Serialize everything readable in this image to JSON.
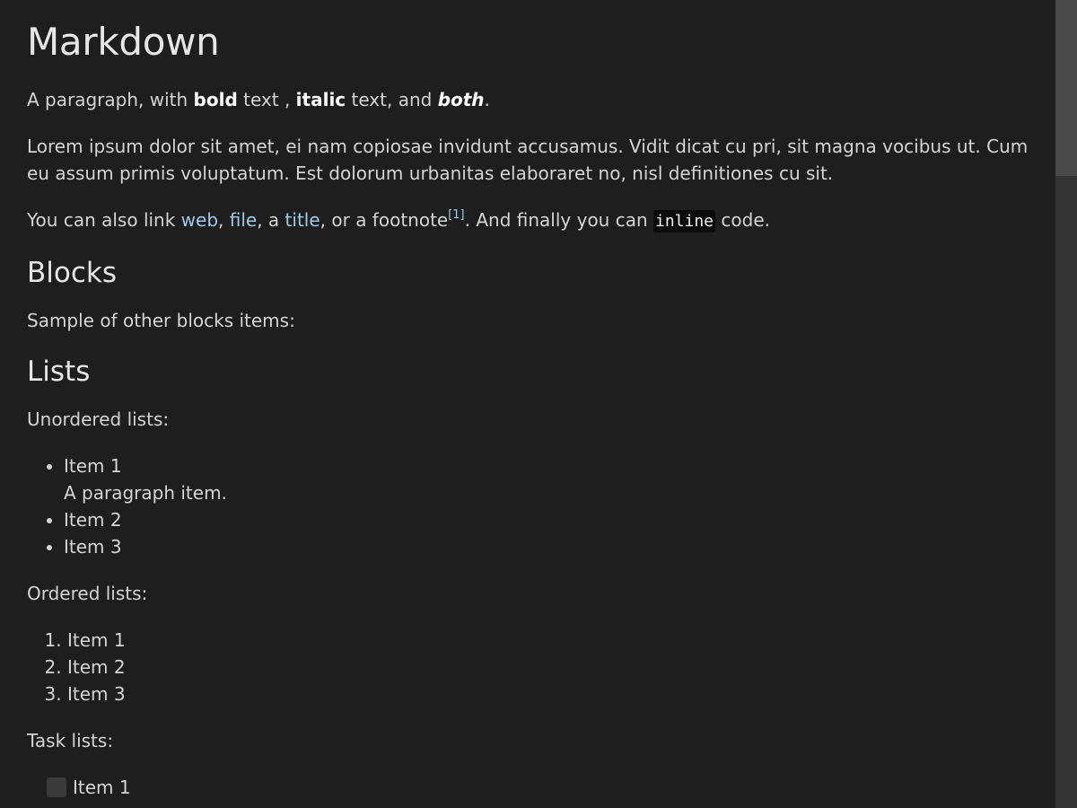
{
  "title": "Markdown",
  "intro": {
    "t1": "A paragraph, with ",
    "bold": "bold",
    "t2": " text , ",
    "italic": "italic",
    "t3": " text, and ",
    "both": "both",
    "t4": "."
  },
  "lorem": "Lorem ipsum dolor sit amet, ei nam copiosae invidunt accusamus. Vidit dicat cu pri, sit magna vocibus ut. Cum eu assum primis voluptatum. Est dolorum urbanitas elaboraret no, nisl definitiones cu sit.",
  "links": {
    "t1": "You can also link ",
    "web": "web",
    "sep1": ", ",
    "file": "file",
    "sep2": ", a ",
    "title_link": "title",
    "sep3": ", or a footnote",
    "footnote": "[1]",
    "t2": ". And finally you can ",
    "code": "inline",
    "t3": " code."
  },
  "blocks": {
    "heading": "Blocks",
    "intro": "Sample of other blocks items:"
  },
  "lists": {
    "heading": "Lists",
    "unordered_label": "Unordered lists:",
    "unordered": [
      "Item 1",
      "Item 2",
      "Item 3"
    ],
    "unordered_sub": "A paragraph item.",
    "ordered_label": "Ordered lists:",
    "ordered": [
      "Item 1",
      "Item 2",
      "Item 3"
    ],
    "task_label": "Task lists:",
    "tasks": [
      {
        "label": "Item 1",
        "checked": false
      }
    ]
  },
  "colors": {
    "background": "#1e1e1e",
    "text": "#d4d4d4",
    "link": "#9ccce8",
    "code_bg": "#0b0b0b",
    "scrollbar_track": "#333333",
    "scrollbar_thumb": "#4a4a4a"
  }
}
